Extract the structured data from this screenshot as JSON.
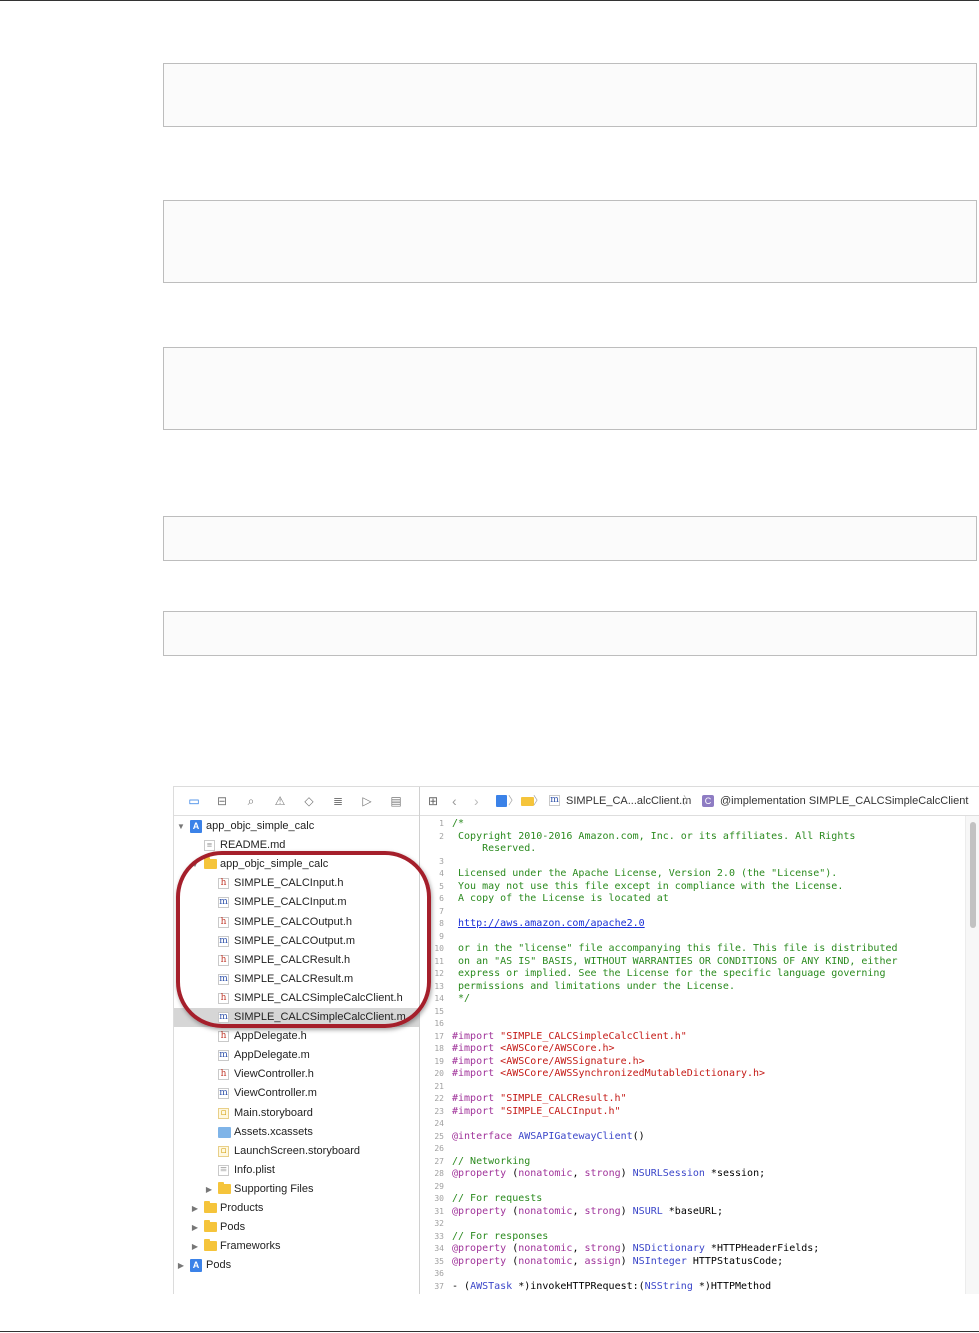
{
  "code_boxes": [
    {
      "lines": []
    },
    {
      "lines": []
    },
    {
      "lines": []
    },
    {
      "lines": []
    },
    {
      "lines": []
    }
  ],
  "navigator": {
    "toolbar_icons": [
      "folder-icon",
      "hierarchy-icon",
      "search-icon",
      "warning-icon",
      "test-icon",
      "debug-icon",
      "breakpoint-icon",
      "report-icon"
    ],
    "tree": [
      {
        "label": "app_objc_simple_calc",
        "icon": "project",
        "indent": 0,
        "disclosure": "open"
      },
      {
        "label": "README.md",
        "icon": "md",
        "indent": 1
      },
      {
        "label": "app_objc_simple_calc",
        "icon": "folder",
        "indent": 1,
        "disclosure": "open"
      },
      {
        "label": "SIMPLE_CALCInput.h",
        "icon": "h",
        "indent": 2
      },
      {
        "label": "SIMPLE_CALCInput.m",
        "icon": "m",
        "indent": 2
      },
      {
        "label": "SIMPLE_CALCOutput.h",
        "icon": "h",
        "indent": 2
      },
      {
        "label": "SIMPLE_CALCOutput.m",
        "icon": "m",
        "indent": 2
      },
      {
        "label": "SIMPLE_CALCResult.h",
        "icon": "h",
        "indent": 2
      },
      {
        "label": "SIMPLE_CALCResult.m",
        "icon": "m",
        "indent": 2
      },
      {
        "label": "SIMPLE_CALCSimpleCalcClient.h",
        "icon": "h",
        "indent": 2
      },
      {
        "label": "SIMPLE_CALCSimpleCalcClient.m",
        "icon": "m",
        "indent": 2,
        "selected": true
      },
      {
        "label": "AppDelegate.h",
        "icon": "h",
        "indent": 2
      },
      {
        "label": "AppDelegate.m",
        "icon": "m",
        "indent": 2
      },
      {
        "label": "ViewController.h",
        "icon": "h",
        "indent": 2
      },
      {
        "label": "ViewController.m",
        "icon": "m",
        "indent": 2
      },
      {
        "label": "Main.storyboard",
        "icon": "sb",
        "indent": 2
      },
      {
        "label": "Assets.xcassets",
        "icon": "xcassets",
        "indent": 2
      },
      {
        "label": "LaunchScreen.storyboard",
        "icon": "sb",
        "indent": 2
      },
      {
        "label": "Info.plist",
        "icon": "pl",
        "indent": 2
      },
      {
        "label": "Supporting Files",
        "icon": "folder",
        "indent": 2,
        "disclosure": "closed"
      },
      {
        "label": "Products",
        "icon": "folder",
        "indent": 1,
        "disclosure": "closed"
      },
      {
        "label": "Pods",
        "icon": "folder",
        "indent": 1,
        "disclosure": "closed"
      },
      {
        "label": "Frameworks",
        "icon": "folder",
        "indent": 1,
        "disclosure": "closed"
      },
      {
        "label": "Pods",
        "icon": "project",
        "indent": 0,
        "disclosure": "closed"
      }
    ]
  },
  "jumpbar": {
    "file_label": "SIMPLE_CA...alcClient.m",
    "symbol_label": "@implementation SIMPLE_CALCSimpleCalcClient",
    "sep": "〉"
  },
  "editor": {
    "lines": [
      {
        "n": "1",
        "t": "/*",
        "c": "cm"
      },
      {
        "n": "2",
        "t": " Copyright 2010-2016 Amazon.com, Inc. or its affiliates. All Rights",
        "c": "cm"
      },
      {
        "n": "",
        "t": "     Reserved.",
        "c": "cm"
      },
      {
        "n": "3",
        "t": "",
        "c": "cm"
      },
      {
        "n": "4",
        "t": " Licensed under the Apache License, Version 2.0 (the \"License\").",
        "c": "cm"
      },
      {
        "n": "5",
        "t": " You may not use this file except in compliance with the License.",
        "c": "cm"
      },
      {
        "n": "6",
        "t": " A copy of the License is located at",
        "c": "cm"
      },
      {
        "n": "7",
        "t": "",
        "c": "cm"
      },
      {
        "n": "8",
        "t": " http://aws.amazon.com/apache2.0",
        "c": "lnk"
      },
      {
        "n": "9",
        "t": "",
        "c": "cm"
      },
      {
        "n": "10",
        "t": " or in the \"license\" file accompanying this file. This file is distributed",
        "c": "cm"
      },
      {
        "n": "11",
        "t": " on an \"AS IS\" BASIS, WITHOUT WARRANTIES OR CONDITIONS OF ANY KIND, either",
        "c": "cm"
      },
      {
        "n": "12",
        "t": " express or implied. See the License for the specific language governing",
        "c": "cm"
      },
      {
        "n": "13",
        "t": " permissions and limitations under the License.",
        "c": "cm"
      },
      {
        "n": "14",
        "t": " */",
        "c": "cm"
      },
      {
        "n": "15",
        "t": "",
        "c": ""
      },
      {
        "n": "16",
        "t": "",
        "c": ""
      },
      {
        "n": "17",
        "t": "#import \"SIMPLE_CALCSimpleCalcClient.h\"",
        "c": "imp"
      },
      {
        "n": "18",
        "t": "#import <AWSCore/AWSCore.h>",
        "c": "imp"
      },
      {
        "n": "19",
        "t": "#import <AWSCore/AWSSignature.h>",
        "c": "imp"
      },
      {
        "n": "20",
        "t": "#import <AWSCore/AWSSynchronizedMutableDictionary.h>",
        "c": "imp"
      },
      {
        "n": "21",
        "t": "",
        "c": ""
      },
      {
        "n": "22",
        "t": "#import \"SIMPLE_CALCResult.h\"",
        "c": "imp"
      },
      {
        "n": "23",
        "t": "#import \"SIMPLE_CALCInput.h\"",
        "c": "imp"
      },
      {
        "n": "24",
        "t": "",
        "c": ""
      },
      {
        "n": "25",
        "t": "@interface AWSAPIGatewayClient()",
        "c": "iface"
      },
      {
        "n": "26",
        "t": "",
        "c": ""
      },
      {
        "n": "27",
        "t": "// Networking",
        "c": "cm"
      },
      {
        "n": "28",
        "t": "@property (nonatomic, strong) NSURLSession *session;",
        "c": "prop"
      },
      {
        "n": "29",
        "t": "",
        "c": ""
      },
      {
        "n": "30",
        "t": "// For requests",
        "c": "cm"
      },
      {
        "n": "31",
        "t": "@property (nonatomic, strong) NSURL *baseURL;",
        "c": "prop"
      },
      {
        "n": "32",
        "t": "",
        "c": ""
      },
      {
        "n": "33",
        "t": "// For responses",
        "c": "cm"
      },
      {
        "n": "34",
        "t": "@property (nonatomic, strong) NSDictionary *HTTPHeaderFields;",
        "c": "prop"
      },
      {
        "n": "35",
        "t": "@property (nonatomic, assign) NSInteger HTTPStatusCode;",
        "c": "prop"
      },
      {
        "n": "36",
        "t": "",
        "c": ""
      },
      {
        "n": "37",
        "t": "- (AWSTask *)invokeHTTPRequest:(NSString *)HTTPMethod",
        "c": "meth"
      }
    ]
  }
}
